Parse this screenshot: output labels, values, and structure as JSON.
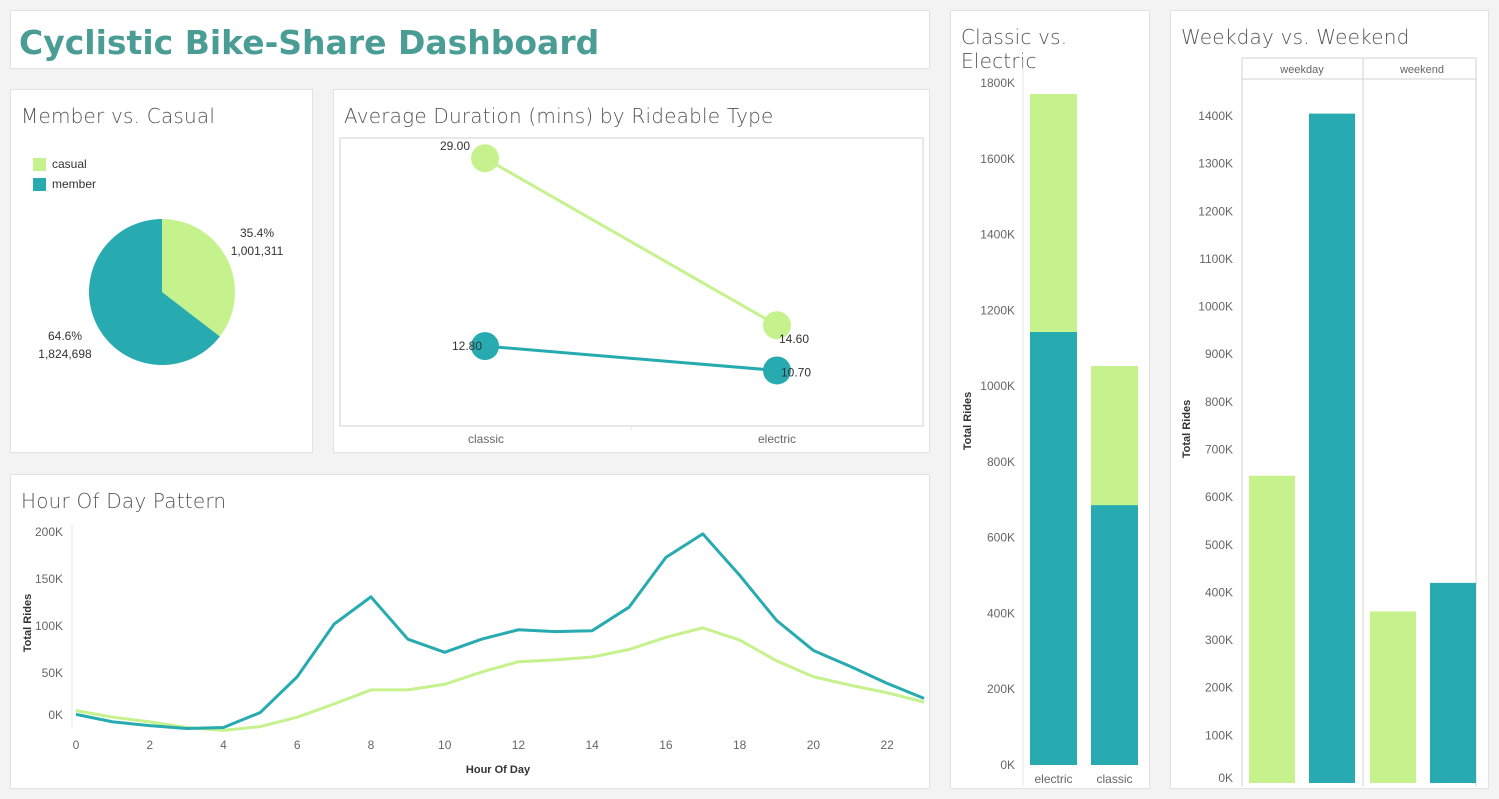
{
  "dashboard": {
    "title": "Cyclistic Bike-Share Dashboard"
  },
  "colors": {
    "casual": "#c6f28e",
    "member": "#27abb0",
    "title": "#4a9d94"
  },
  "pie": {
    "title": "Member vs. Casual",
    "legend": [
      {
        "label": "casual",
        "color": "#c6f28e"
      },
      {
        "label": "member",
        "color": "#27abb0"
      }
    ],
    "casual_label": {
      "pct": "35.4%",
      "count": "1,001,311"
    },
    "member_label": {
      "pct": "64.6%",
      "count": "1,824,698"
    }
  },
  "duration": {
    "title": "Average Duration (mins) by Rideable Type",
    "labels": {
      "casual_classic": "29.00",
      "casual_electric": "14.60",
      "member_classic": "12.80",
      "member_electric": "10.70"
    },
    "x_labels": [
      "classic",
      "electric"
    ]
  },
  "hourly": {
    "title": "Hour Of Day Pattern",
    "ylabel": "Total Rides",
    "xlabel": "Hour Of Day",
    "y_ticks": [
      "0K",
      "50K",
      "100K",
      "150K",
      "200K"
    ],
    "x_ticks": [
      "0",
      "2",
      "4",
      "6",
      "8",
      "10",
      "12",
      "14",
      "16",
      "18",
      "20",
      "22"
    ]
  },
  "classic_electric": {
    "title": "Classic vs. Electric",
    "ylabel": "Total Rides",
    "y_ticks": [
      "0K",
      "200K",
      "400K",
      "600K",
      "800K",
      "1000K",
      "1200K",
      "1400K",
      "1600K",
      "1800K"
    ],
    "categories": [
      "electric",
      "classic"
    ]
  },
  "weekday_weekend": {
    "title": "Weekday vs. Weekend",
    "ylabel": "Total Rides",
    "y_ticks": [
      "0K",
      "100K",
      "200K",
      "300K",
      "400K",
      "500K",
      "600K",
      "700K",
      "800K",
      "900K",
      "1000K",
      "1100K",
      "1200K",
      "1300K",
      "1400K"
    ],
    "groups": [
      "weekday",
      "weekend"
    ]
  },
  "chart_data": [
    {
      "type": "pie",
      "title": "Member vs. Casual",
      "slices": [
        {
          "label": "casual",
          "value": 1001311,
          "pct": 35.4
        },
        {
          "label": "member",
          "value": 1824698,
          "pct": 64.6
        }
      ]
    },
    {
      "type": "line",
      "title": "Average Duration (mins) by Rideable Type",
      "categories": [
        "classic",
        "electric"
      ],
      "series": [
        {
          "name": "casual",
          "values": [
            29.0,
            14.6
          ]
        },
        {
          "name": "member",
          "values": [
            12.8,
            10.7
          ]
        }
      ]
    },
    {
      "type": "line",
      "title": "Hour Of Day Pattern",
      "xlabel": "Hour Of Day",
      "ylabel": "Total Rides",
      "x": [
        0,
        1,
        2,
        3,
        4,
        5,
        6,
        7,
        8,
        9,
        10,
        11,
        12,
        13,
        14,
        15,
        16,
        17,
        18,
        19,
        20,
        21,
        22,
        23
      ],
      "ylim": [
        0,
        200000
      ],
      "series": [
        {
          "name": "member",
          "values": [
            6000,
            -2000,
            -6000,
            -9000,
            -8000,
            8000,
            46000,
            102000,
            131000,
            86000,
            72000,
            86000,
            96000,
            94000,
            95000,
            120000,
            173000,
            198000,
            154000,
            106000,
            74000,
            57000,
            39000,
            23000
          ]
        },
        {
          "name": "casual",
          "values": [
            10000,
            3000,
            -2000,
            -8000,
            -11000,
            -7000,
            3000,
            17000,
            32000,
            32000,
            38000,
            51000,
            62000,
            64000,
            67000,
            75000,
            88000,
            98000,
            85000,
            63000,
            46000,
            37000,
            29000,
            19000
          ]
        }
      ]
    },
    {
      "type": "bar",
      "title": "Classic vs. Electric",
      "ylabel": "Total Rides",
      "categories": [
        "electric",
        "classic"
      ],
      "ylim": [
        0,
        1800000
      ],
      "stacked": true,
      "series": [
        {
          "name": "member",
          "values": [
            1143000,
            686000
          ]
        },
        {
          "name": "casual",
          "values": [
            628000,
            367000
          ]
        }
      ]
    },
    {
      "type": "bar",
      "title": "Weekday vs. Weekend",
      "ylabel": "Total Rides",
      "categories": [
        "weekday",
        "weekend"
      ],
      "ylim": [
        0,
        1400000
      ],
      "series": [
        {
          "name": "casual",
          "values": [
            645000,
            360000
          ]
        },
        {
          "name": "member",
          "values": [
            1405000,
            420000
          ]
        }
      ]
    }
  ]
}
